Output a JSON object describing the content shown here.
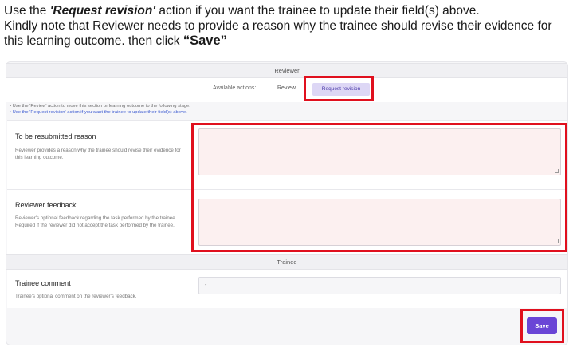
{
  "instructions": {
    "line1_prefix": "Use the ",
    "line1_action": "'Request revision'",
    "line1_suffix": " action if you want the trainee to update their field(s) above.",
    "line2": "Kindly note that Reviewer needs to provide a reason why the trainee should revise their evidence for this learning outcome. then click ",
    "save_word": "“Save”"
  },
  "reviewer": {
    "section_title": "Reviewer",
    "actions_label": "Available actions:",
    "action_review": "Review",
    "action_request_revision": "Request revision",
    "hint_review": "•  Use the 'Review' action to move this section or learning outcome to the following stage.",
    "hint_request": "•  Use the 'Request revision' action if you want the trainee to update their field(s) above.",
    "resubmit": {
      "title": "To be resubmitted reason",
      "description": "Reviewer provides a reason why the trainee should revise their evidence for this learning outcome."
    },
    "feedback": {
      "title": "Reviewer feedback",
      "description": "Reviewer's optional feedback regarding the task performed by the trainee. Required if the reviewer did not accept the task performed by the trainee."
    }
  },
  "trainee": {
    "section_title": "Trainee",
    "comment_title": "Trainee comment",
    "comment_description": "Trainee's optional comment on the reviewer's feedback.",
    "comment_value": "-"
  },
  "footer": {
    "save_label": "Save"
  },
  "colors": {
    "highlight": "#e0101e",
    "accent": "#6a45d6",
    "field_bg": "#fcf0f0"
  }
}
